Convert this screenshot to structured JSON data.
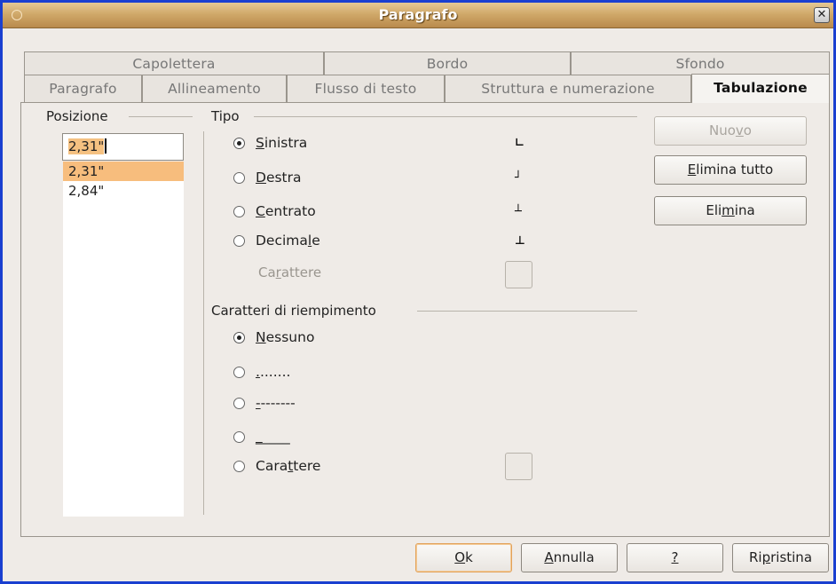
{
  "window": {
    "title": "Paragrafo"
  },
  "tabs_row1": [
    "Capolettera",
    "Bordo",
    "Sfondo"
  ],
  "tabs_row2": [
    "Paragrafo",
    "Allineamento",
    "Flusso di testo",
    "Struttura e numerazione",
    "Tabulazione"
  ],
  "active_tab": "Tabulazione",
  "posizione": {
    "label": "Posizione",
    "input_value": "2,31\"",
    "items": [
      "2,31\"",
      "2,84\""
    ],
    "selected_index": 0
  },
  "tipo": {
    "label": "Tipo",
    "options": [
      {
        "pre": "",
        "u": "S",
        "post": "inistra",
        "checked": true,
        "glyph": "∟"
      },
      {
        "pre": "",
        "u": "D",
        "post": "estra",
        "checked": false,
        "glyph": "┘"
      },
      {
        "pre": "",
        "u": "C",
        "post": "entrato",
        "checked": false,
        "glyph": "┴"
      },
      {
        "pre": "Decima",
        "u": "l",
        "post": "e",
        "checked": false,
        "glyph": "⊥"
      }
    ],
    "carattere": {
      "pre": "Ca",
      "u": "r",
      "post": "attere"
    }
  },
  "riempimento": {
    "label": "Caratteri di riempimento",
    "options": [
      {
        "pre": "",
        "u": "N",
        "post": "essuno",
        "checked": true
      },
      {
        "pre": "",
        "u": ".",
        "post": ".......",
        "checked": false
      },
      {
        "pre": "",
        "u": "-",
        "post": "-------",
        "checked": false
      },
      {
        "pre": "",
        "u": "_",
        "post": "____",
        "checked": false
      },
      {
        "pre": "Cara",
        "u": "t",
        "post": "tere",
        "checked": false
      }
    ]
  },
  "side_buttons": [
    {
      "pre": "Nuo",
      "u": "v",
      "post": "o",
      "disabled": true
    },
    {
      "pre": "",
      "u": "E",
      "post": "limina tutto",
      "disabled": false
    },
    {
      "pre": "Eli",
      "u": "m",
      "post": "ina",
      "disabled": false
    }
  ],
  "bottom_buttons": [
    {
      "pre": "",
      "u": "O",
      "post": "k"
    },
    {
      "pre": "",
      "u": "A",
      "post": "nnulla"
    },
    {
      "pre": "",
      "u": "?",
      "post": ""
    },
    {
      "pre": "Ri",
      "u": "p",
      "post": "ristina"
    }
  ],
  "colors": {
    "titlebar": "#c9a063",
    "selection": "#f7bd7d",
    "frame": "#1a3fd0"
  }
}
